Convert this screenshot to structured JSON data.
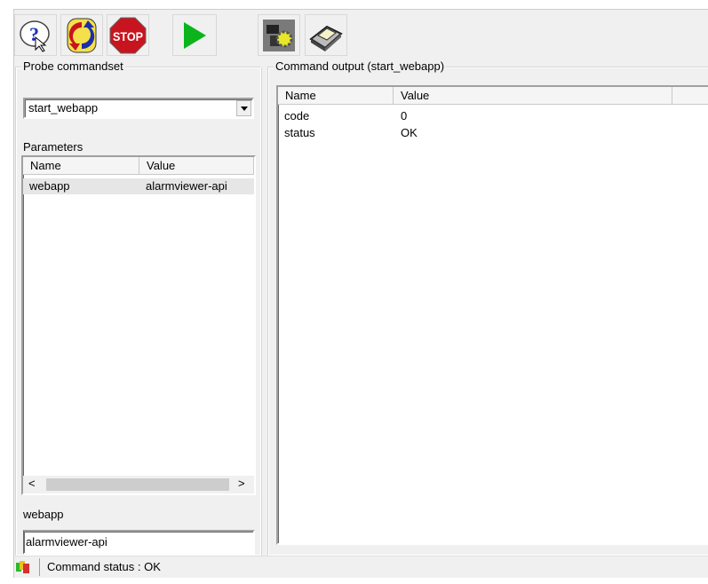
{
  "toolbar": {
    "buttons": [
      {
        "name": "help",
        "icon": "help-icon"
      },
      {
        "name": "refresh",
        "icon": "refresh-icon"
      },
      {
        "name": "stop",
        "icon": "stop-icon",
        "label": "STOP"
      },
      {
        "name": "run",
        "icon": "play-icon"
      },
      {
        "name": "configure",
        "icon": "gear-icon"
      },
      {
        "name": "print",
        "icon": "printer-icon"
      }
    ]
  },
  "left": {
    "group_title": "Probe commandset",
    "commandset_selected": "start_webapp",
    "parameters_label": "Parameters",
    "columns": [
      "Name",
      "Value"
    ],
    "rows": [
      {
        "name": "webapp",
        "value": "alarmviewer-api"
      }
    ],
    "field_label": "webapp",
    "field_value": "alarmviewer-api"
  },
  "right": {
    "group_title": "Command output (start_webapp)",
    "columns": [
      "Name",
      "Value",
      ""
    ],
    "rows": [
      {
        "name": "code",
        "value": "0"
      },
      {
        "name": "status",
        "value": "OK"
      }
    ]
  },
  "status": {
    "text": "Command status : OK"
  }
}
